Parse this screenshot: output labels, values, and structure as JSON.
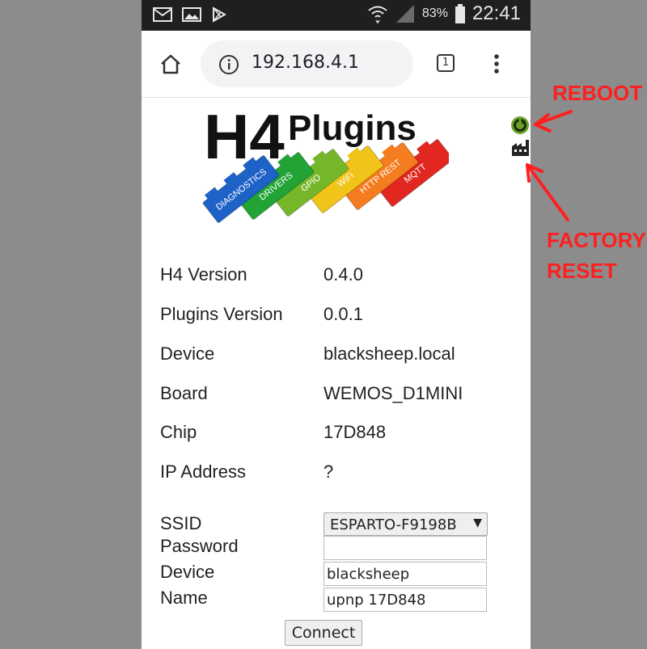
{
  "status_bar": {
    "battery_percent": "83%",
    "time": "22:41",
    "left_icons": [
      "mail-icon",
      "image-icon",
      "play-store-icon"
    ],
    "right_icons": [
      "wifi-icon",
      "signal-icon",
      "battery-icon"
    ]
  },
  "browser": {
    "url": "192.168.4.1",
    "tab_count": "1"
  },
  "logo": {
    "title_a": "H4",
    "title_b": "Plugins",
    "bricks": [
      "DIAGNOSTICS",
      "DRIVERS",
      "GPIO",
      "WiFi",
      "HTTP REST",
      "MQTT"
    ],
    "brick_colors": [
      "#1e62c8",
      "#21a336",
      "#76b72a",
      "#f0c418",
      "#f57c1f",
      "#e1271f"
    ]
  },
  "info": [
    {
      "label": "H4 Version",
      "value": "0.4.0"
    },
    {
      "label": "Plugins Version",
      "value": "0.0.1"
    },
    {
      "label": "Device",
      "value": "blacksheep.local"
    },
    {
      "label": "Board",
      "value": "WEMOS_D1MINI"
    },
    {
      "label": "Chip",
      "value": "17D848"
    },
    {
      "label": "IP Address",
      "value": "?"
    }
  ],
  "form": {
    "ssid_label": "SSID",
    "ssid_selected": "ESPARTO-F9198B",
    "password_label": "Password",
    "password_value": "",
    "device_label": "Device",
    "device_value": "blacksheep",
    "name_label": "Name",
    "name_value": "upnp 17D848",
    "connect_label": "Connect"
  },
  "annotations": {
    "reboot": "REBOOT",
    "factory_reset_line1": "FACTORY",
    "factory_reset_line2": "RESET",
    "color": "#ff1f1f"
  }
}
